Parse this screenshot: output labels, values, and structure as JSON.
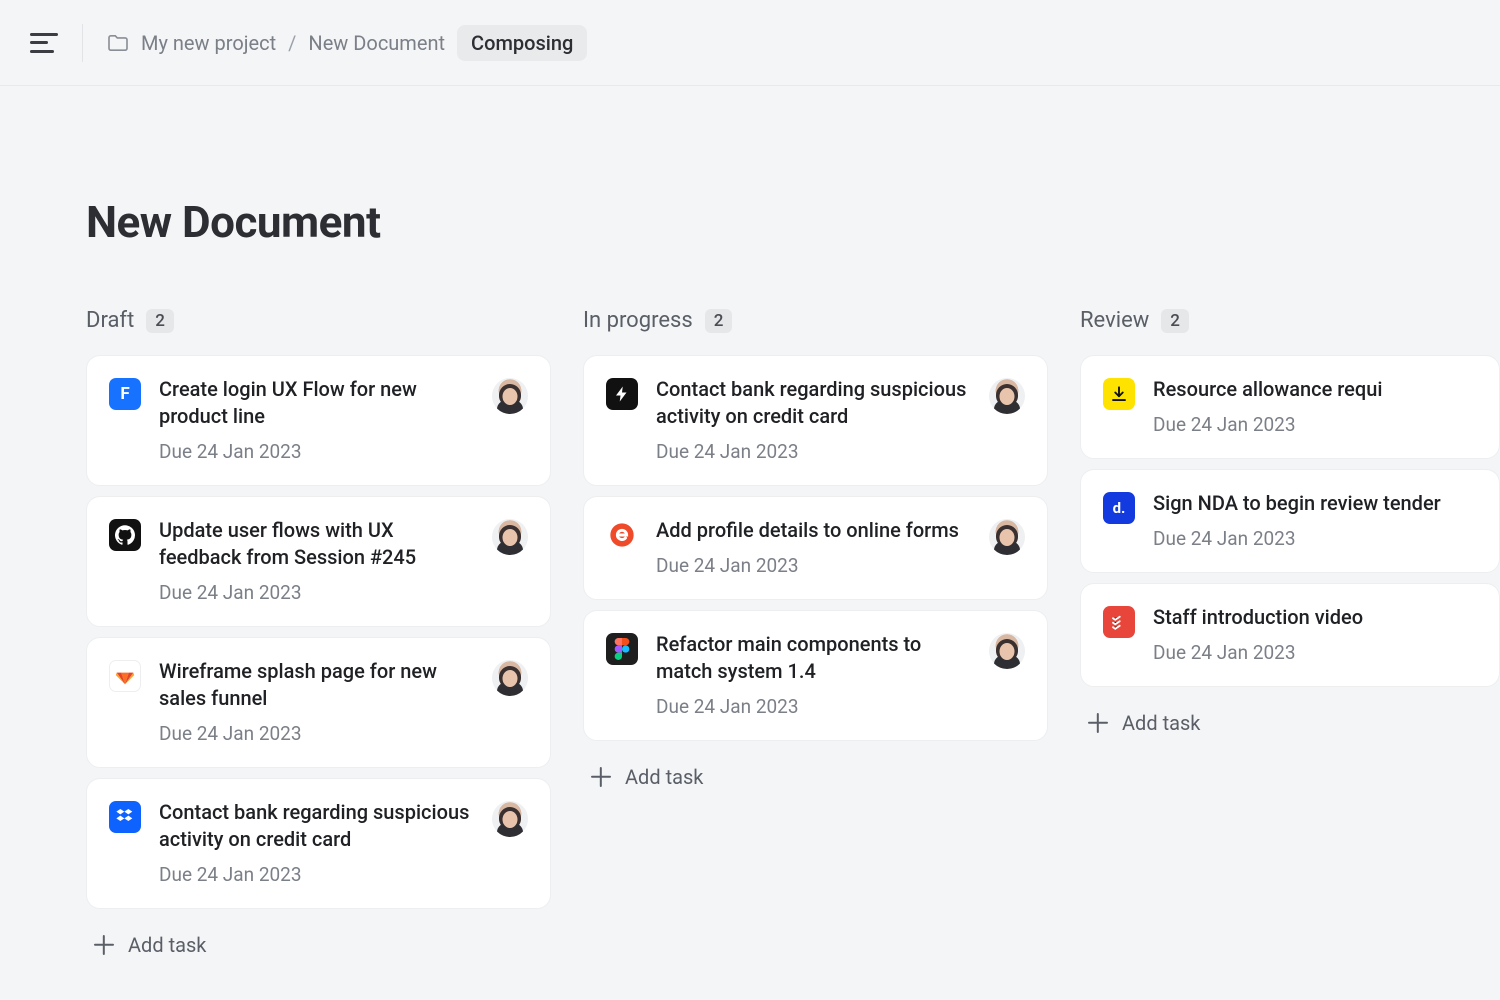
{
  "breadcrumb": {
    "project": "My new project",
    "document": "New Document",
    "mode": "Composing"
  },
  "page": {
    "title": "New Document"
  },
  "add_task_label": "Add task",
  "columns": [
    {
      "name": "Draft",
      "count": "2",
      "cards": [
        {
          "icon": "framer",
          "title": "Create login UX Flow for new product line",
          "due": "Due 24 Jan 2023"
        },
        {
          "icon": "github",
          "title": "Update user flows with UX feedback from Session #245",
          "due": "Due 24 Jan 2023"
        },
        {
          "icon": "gitlab",
          "title": "Wireframe splash page for new sales funnel",
          "due": "Due 24 Jan 2023"
        },
        {
          "icon": "dropbox",
          "title": "Contact bank regarding suspicious activity on credit card",
          "due": "Due 24 Jan 2023"
        }
      ]
    },
    {
      "name": "In progress",
      "count": "2",
      "cards": [
        {
          "icon": "bolt",
          "title": "Contact bank regarding suspicious activity on credit card",
          "due": "Due 24 Jan 2023"
        },
        {
          "icon": "e",
          "title": "Add profile details to online forms",
          "due": "Due 24 Jan 2023"
        },
        {
          "icon": "figma",
          "title": "Refactor main components to match system 1.4",
          "due": "Due 24 Jan 2023"
        }
      ]
    },
    {
      "name": "Review",
      "count": "2",
      "cards": [
        {
          "icon": "dl",
          "title": "Resource allowance requi",
          "due": "Due 24 Jan 2023"
        },
        {
          "icon": "d",
          "title": "Sign NDA to begin review tender",
          "due": "Due 24 Jan 2023"
        },
        {
          "icon": "todoist",
          "title": "Staff introduction video",
          "due": "Due 24 Jan 2023"
        }
      ]
    }
  ]
}
